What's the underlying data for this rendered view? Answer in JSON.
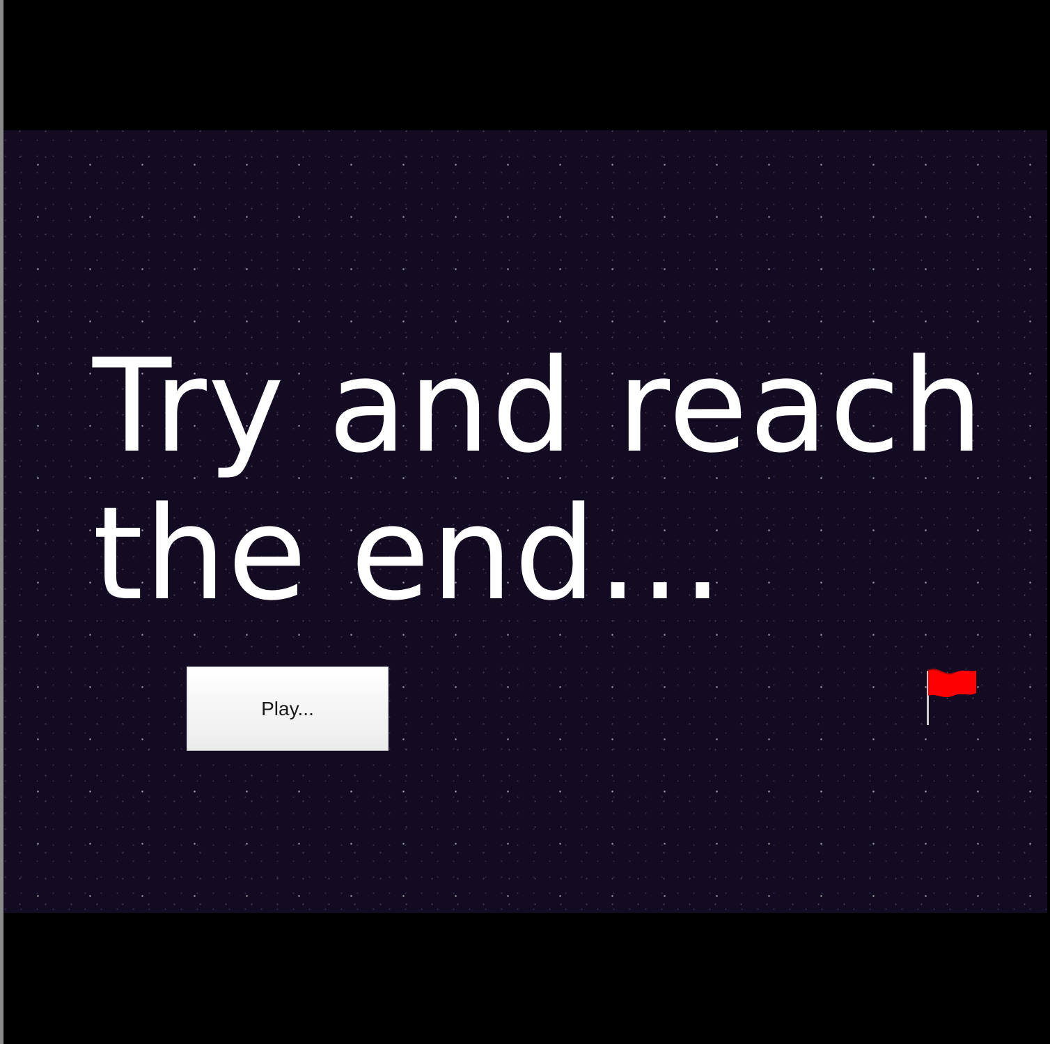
{
  "game": {
    "title": "Try and reach\nthe end...",
    "play_button_label": "Play...",
    "goal_icon": "red-flag-icon"
  },
  "colors": {
    "background": "#130b22",
    "letterbox": "#000000",
    "title_text": "#ffffff",
    "flag": "#ff0000"
  }
}
